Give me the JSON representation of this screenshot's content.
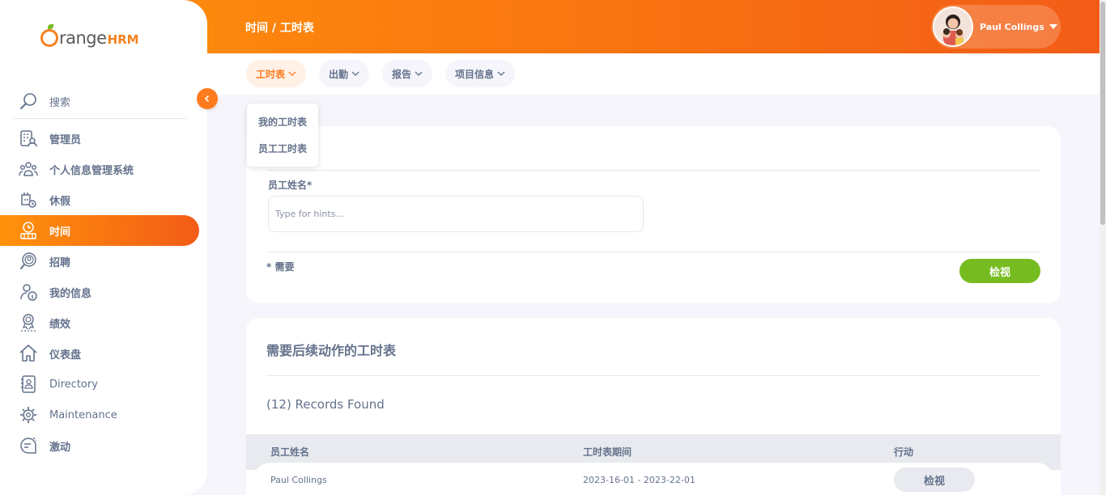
{
  "logo": {
    "part1": "range",
    "part2": "HRM"
  },
  "breadcrumb": "时间 / 工时表",
  "user": {
    "name": "Paul Collings"
  },
  "sidebar": {
    "search_label": "搜索",
    "items": [
      {
        "label": "管理员",
        "icon": "admin-icon"
      },
      {
        "label": "个人信息管理系统",
        "icon": "pim-icon"
      },
      {
        "label": "休假",
        "icon": "leave-icon"
      },
      {
        "label": "时间",
        "icon": "time-icon",
        "active": true
      },
      {
        "label": "招聘",
        "icon": "recruitment-icon"
      },
      {
        "label": "我的信息",
        "icon": "my-info-icon"
      },
      {
        "label": "绩效",
        "icon": "performance-icon"
      },
      {
        "label": "仪表盘",
        "icon": "dashboard-icon"
      },
      {
        "label": "Directory",
        "icon": "directory-icon"
      },
      {
        "label": "Maintenance",
        "icon": "maintenance-icon"
      },
      {
        "label": "激动",
        "icon": "buzz-icon"
      }
    ]
  },
  "subnav": {
    "timesheets": "工时表",
    "attendance": "出勤",
    "reports": "报告",
    "project_info": "项目信息"
  },
  "dropdown": {
    "my_timesheets": "我的工时表",
    "employee_timesheets": "员工工时表"
  },
  "form": {
    "employee_name_label": "员工姓名*",
    "employee_name_placeholder": "Type for hints...",
    "required_note": "* 需要",
    "view_button": "检视"
  },
  "pending": {
    "title": "需要后续动作的工时表",
    "records_found": "(12) Records Found",
    "columns": [
      "员工姓名",
      "工时表期间",
      "行动"
    ],
    "rows": [
      {
        "employee": "Paul Collings",
        "period": "2023-16-01 - 2023-22-01",
        "action": "检视"
      }
    ]
  }
}
